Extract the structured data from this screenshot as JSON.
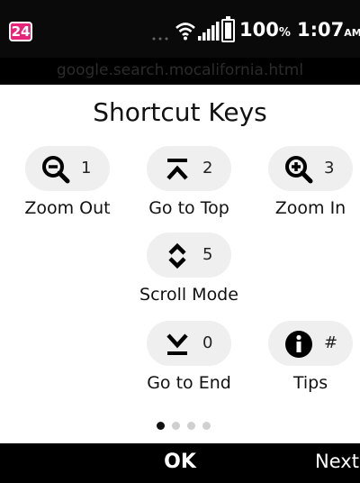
{
  "status": {
    "notification_count": "24",
    "battery_percent": "100",
    "percent_sign": "%",
    "time": "1:07",
    "ampm": "AM"
  },
  "browser": {
    "url": "google.search.mocalifornia.html"
  },
  "dialog": {
    "title": "Shortcut Keys",
    "shortcuts": [
      {
        "icon": "zoom-out-icon",
        "key": "1",
        "label": "Zoom Out"
      },
      {
        "icon": "go-to-top-icon",
        "key": "2",
        "label": "Go to Top"
      },
      {
        "icon": "zoom-in-icon",
        "key": "3",
        "label": "Zoom In"
      },
      {
        "icon": "scroll-mode-icon",
        "key": "5",
        "label": "Scroll Mode"
      },
      {
        "icon": "go-to-end-icon",
        "key": "0",
        "label": "Go to End"
      },
      {
        "icon": "info-icon",
        "key": "#",
        "label": "Tips"
      }
    ],
    "pager": {
      "current_page": 1,
      "page_count": 4
    }
  },
  "softkeys": {
    "center": "OK",
    "right": "Next"
  },
  "colors": {
    "badge": "#e6247a",
    "dialog_bg": "#ffffff",
    "pill_bg": "#efefef",
    "bar_bg": "#000000"
  }
}
